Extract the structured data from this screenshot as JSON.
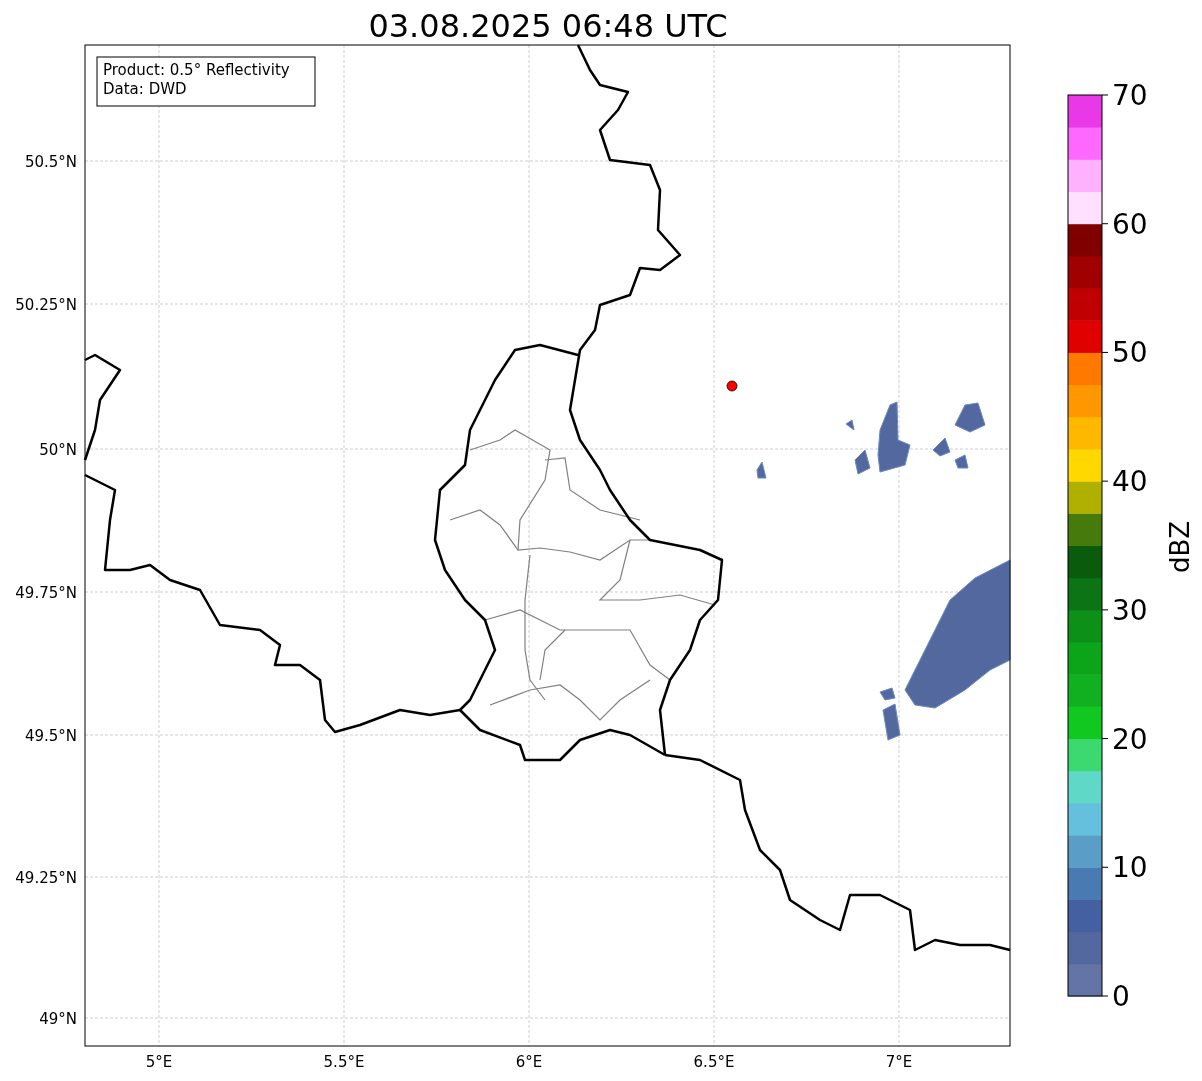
{
  "title": "03.08.2025 06:48 UTC",
  "info_box": [
    "Product: 0.5° Reflectivity",
    "Data: DWD"
  ],
  "lat_ticks": [
    "50.5°N",
    "50.25°N",
    "50°N",
    "49.75°N",
    "49.5°N",
    "49.25°N",
    "49°N"
  ],
  "lon_ticks": [
    "5°E",
    "5.5°E",
    "6°E",
    "6.5°E",
    "7°E"
  ],
  "colorbar": {
    "label": "dBZ",
    "ticks": [
      "70",
      "60",
      "50",
      "40",
      "30",
      "20",
      "10",
      "0"
    ],
    "bins": [
      {
        "color": "#6474a6"
      },
      {
        "color": "#5468a0"
      },
      {
        "color": "#4460a0"
      },
      {
        "color": "#4a7ab2"
      },
      {
        "color": "#5a9ec8"
      },
      {
        "color": "#64c0dc"
      },
      {
        "color": "#60d8c8"
      },
      {
        "color": "#3cd870"
      },
      {
        "color": "#10c820"
      },
      {
        "color": "#10b020"
      },
      {
        "color": "#0ca418"
      },
      {
        "color": "#0c9018"
      },
      {
        "color": "#0c7414"
      },
      {
        "color": "#0a5c0c"
      },
      {
        "color": "#467a0c"
      },
      {
        "color": "#b0b000"
      },
      {
        "color": "#ffd800"
      },
      {
        "color": "#ffb800"
      },
      {
        "color": "#ff9800"
      },
      {
        "color": "#ff7800"
      },
      {
        "color": "#e00000"
      },
      {
        "color": "#c00000"
      },
      {
        "color": "#a00000"
      },
      {
        "color": "#800000"
      },
      {
        "color": "#ffe0ff"
      },
      {
        "color": "#ffb0ff"
      },
      {
        "color": "#ff68ff"
      },
      {
        "color": "#e838e8"
      }
    ]
  }
}
